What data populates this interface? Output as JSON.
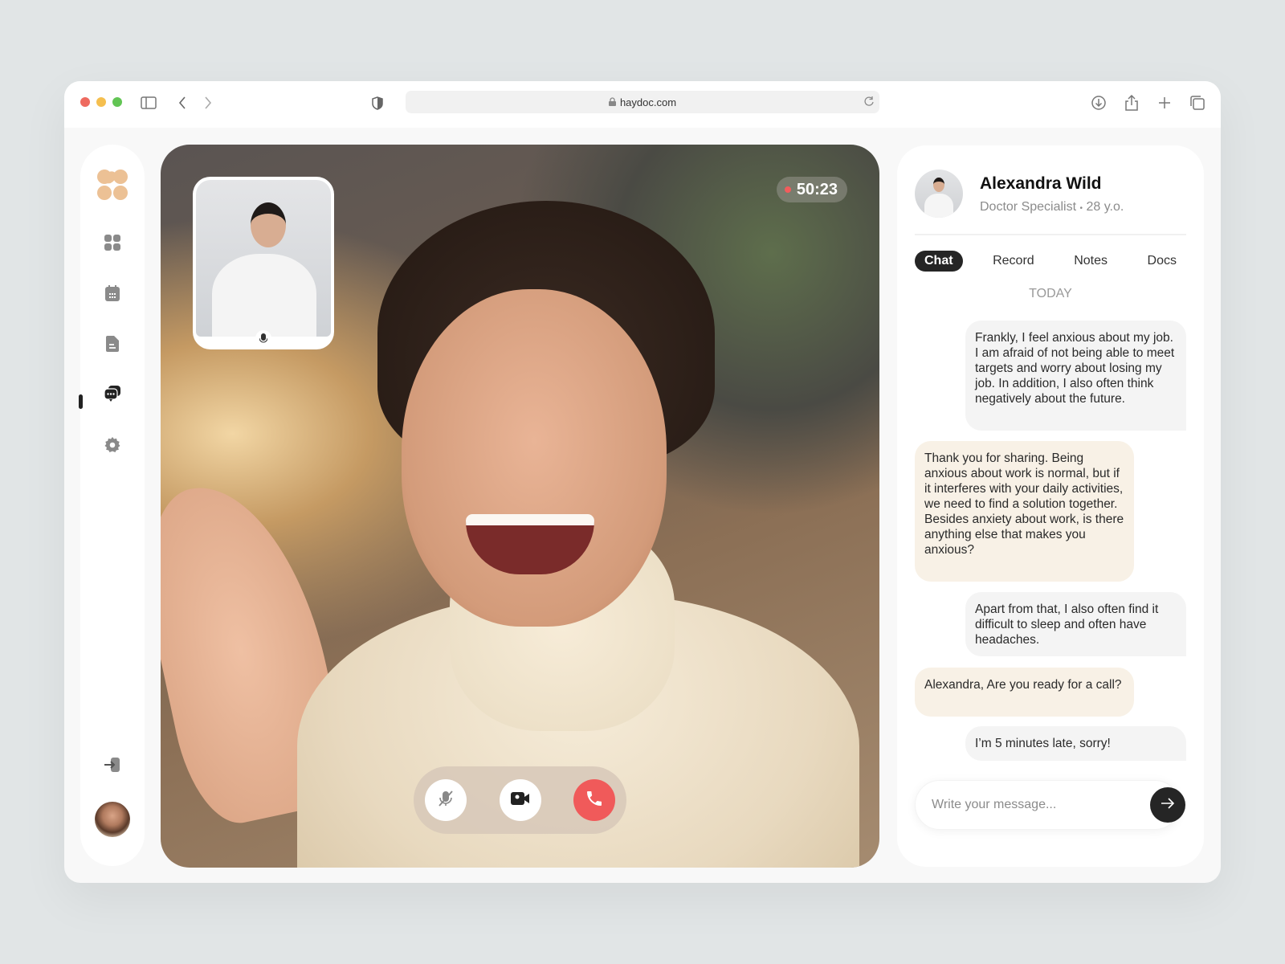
{
  "browser": {
    "url": "haydoc.com"
  },
  "colors": {
    "accent": "#ecc195",
    "end_call": "#f05a5a",
    "doctor_bubble": "#f8f1e6",
    "patient_bubble": "#f4f4f4"
  },
  "sidebar": {
    "items": [
      {
        "icon": "dashboard-icon"
      },
      {
        "icon": "calendar-icon"
      },
      {
        "icon": "document-icon"
      },
      {
        "icon": "chat-icon",
        "active": true
      },
      {
        "icon": "gear-icon"
      }
    ],
    "bottom": [
      {
        "icon": "logout-icon"
      },
      {
        "icon": "user-avatar"
      }
    ]
  },
  "call": {
    "timer": "50:23"
  },
  "profile": {
    "name": "Alexandra Wild",
    "role": "Doctor Specialist",
    "age": "28 y.o.",
    "separator": "•"
  },
  "tabs": [
    {
      "label": "Chat",
      "active": true
    },
    {
      "label": "Record"
    },
    {
      "label": "Notes"
    },
    {
      "label": "Docs"
    }
  ],
  "chat": {
    "date": "TODAY",
    "messages": [
      {
        "from": "me",
        "text": "Frankly, I feel anxious about my job. I am afraid of not being able to meet targets and worry about losing my job. In addition, I also often think negatively about the future."
      },
      {
        "from": "doctor",
        "text": "Thank you for sharing. Being anxious about work is normal, but if it interferes with your daily activities, we need to find a solution together. Besides anxiety about work, is there anything else that makes you anxious?"
      },
      {
        "from": "me",
        "text": "Apart from that, I also often find it difficult to sleep and often have headaches."
      },
      {
        "from": "doctor",
        "text": "Alexandra, Are you ready for a call?"
      },
      {
        "from": "me",
        "text": "I’m 5 minutes late, sorry!"
      }
    ]
  },
  "composer": {
    "placeholder": "Write your message...",
    "value": ""
  }
}
